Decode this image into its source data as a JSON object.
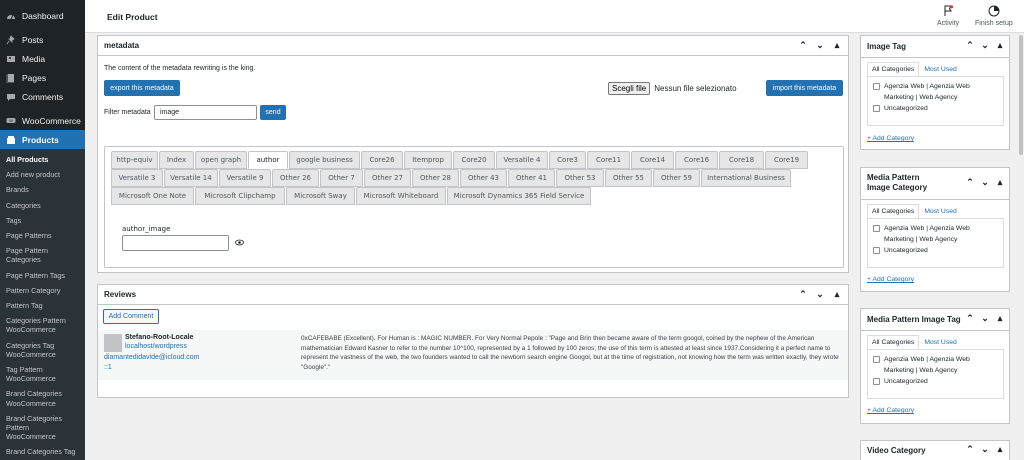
{
  "sidebar": {
    "top_items": [
      {
        "label": "Dashboard",
        "icon": "dashboard-icon"
      },
      {
        "label": "Posts",
        "icon": "pin-icon"
      },
      {
        "label": "Media",
        "icon": "media-icon"
      },
      {
        "label": "Pages",
        "icon": "page-icon"
      },
      {
        "label": "Comments",
        "icon": "comment-icon"
      },
      {
        "label": "WooCommerce",
        "icon": "woo-icon"
      },
      {
        "label": "Products",
        "icon": "products-icon"
      }
    ],
    "submenu": [
      "All Products",
      "Add new product",
      "Brands",
      "Categories",
      "Tags",
      "Page Patterns",
      "Page Pattern Categories",
      "Page Pattern Tags",
      "Pattern Category",
      "Pattern Tag",
      "Categories Pattern WooCommerce",
      "Categories Tag WooCommerce",
      "Tag Pattern WooCommerce",
      "Brand Categories WooCommerce",
      "Brand Categories Pattern WooCommerce",
      "Brand Categories Tag"
    ]
  },
  "header": {
    "title": "Edit Product",
    "activity_label": "Activity",
    "finish_label": "Finish setup"
  },
  "metadata_box": {
    "title": "metadata",
    "description": "The content of the metadata rewriting is the king.",
    "export_label": "export this metadata",
    "choose_file_label": "Scegli file",
    "no_file_label": "Nessun file selezionato",
    "import_label": "import this metadata",
    "filter_label": "Filter metadata",
    "filter_value": "image",
    "send_label": "send",
    "tabs_row1": [
      "http-equiv",
      "Index",
      "open graph",
      "author",
      "google business",
      "Core26",
      "Itemprop",
      "Core20",
      "Versatile 4",
      "Core3",
      "Core11",
      "Core14",
      "Core16",
      "Core18",
      "Core19"
    ],
    "tabs_row2": [
      "Versatile 3",
      "Versatile 14",
      "Versatile 9",
      "Other 26",
      "Other 7",
      "Other 27",
      "Other 28",
      "Other 43",
      "Other 41",
      "Other 53",
      "Other 55",
      "Other 59",
      "International Business"
    ],
    "tabs_row3": [
      "Microsoft One Note",
      "Microsoft Clipchamp",
      "Microsoft Sway",
      "Microsoft Whiteboard",
      "Microsoft Dynamics 365 Field Service"
    ],
    "active_tab": "author",
    "field_label": "author_image",
    "field_value": ""
  },
  "reviews_box": {
    "title": "Reviews",
    "add_comment_label": "Add Comment",
    "author_name": "Stefano-Root-Locale",
    "author_url": "localhost/wordpress",
    "author_email": "diamantedidavide@icloud.com",
    "author_ip": "::1",
    "comment_text": "0xCAFEBABE (Excellent). For Human is : MAGIC NUMBER. For Very Normal Pepole : \"Page and Brin then became aware of the term googol, coined by the nephew of the American mathematician Edward Kasner to refer to the number 10^100, represented by a 1 followed by 100 zeros; the use of this term is attested at least since 1937.Considering it a perfect name to represent the vastness of the web, the two founders wanted to call the newborn search engine Googol, but at the time of registration, not knowing how the term was written exactly, they wrote \"Google\".\""
  },
  "side_boxes": {
    "image_tag": {
      "title": "Image Tag"
    },
    "media_pattern_cat": {
      "title": "Media Pattern Image Category"
    },
    "media_pattern_tag": {
      "title": "Media Pattern Image Tag"
    },
    "video_category": {
      "title": "Video Category"
    },
    "all_categories_label": "All Categories",
    "most_used_label": "Most Used",
    "cat_1": "Agenzia Web | Agenzia Web Marketing | Web Agency",
    "cat_2": "Uncategorized",
    "add_category_label": "+ Add Category"
  },
  "colors": {
    "accent": "#2271b1",
    "sidebar": "#1d2327",
    "submenu": "#2c3338"
  }
}
